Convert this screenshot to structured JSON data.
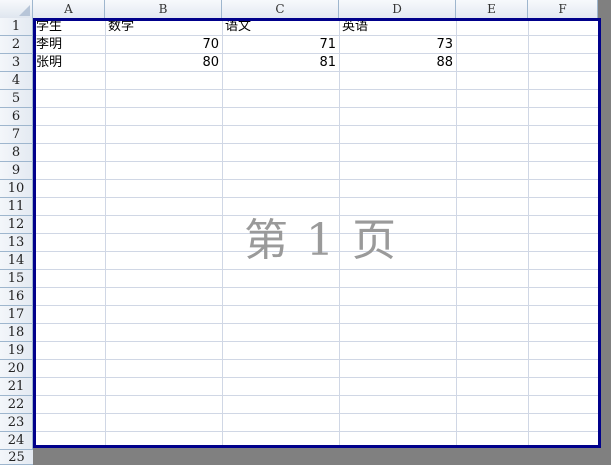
{
  "columns": [
    "A",
    "B",
    "C",
    "D",
    "E",
    "F"
  ],
  "rows": [
    "1",
    "2",
    "3",
    "4",
    "5",
    "6",
    "7",
    "8",
    "9",
    "10",
    "11",
    "12",
    "13",
    "14",
    "15",
    "16",
    "17",
    "18",
    "19",
    "20",
    "21",
    "22",
    "23",
    "24",
    "25"
  ],
  "cells": {
    "A1": "学生",
    "B1": "数学",
    "C1": "语文",
    "D1": "英语",
    "A2": "李明",
    "B2": "70",
    "C2": "71",
    "D2": "73",
    "A3": "张明",
    "B3": "80",
    "C3": "81",
    "D3": "88"
  },
  "watermark": "第 1 页",
  "colors": {
    "print_border": "#00008b",
    "background": "#808080",
    "gridline": "#d0d7e5"
  }
}
